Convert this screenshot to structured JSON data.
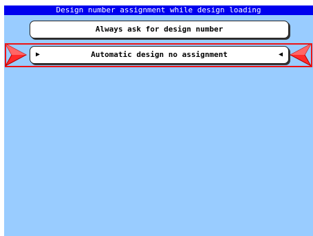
{
  "title": "Design number assignment while design loading",
  "options": [
    {
      "label": "Always ask for design number",
      "selected": false
    },
    {
      "label": "Automatic design no assignment",
      "selected": true
    }
  ],
  "selection_arrows": {
    "left": "▶",
    "right": "◀"
  },
  "colors": {
    "background": "#99ccff",
    "titlebar": "#0000ee",
    "selection_frame": "#ee1111",
    "button": "#ffffff"
  },
  "icons": [
    "pointer-right-icon",
    "pointer-left-icon",
    "arrow-right-icon",
    "arrow-left-icon"
  ]
}
